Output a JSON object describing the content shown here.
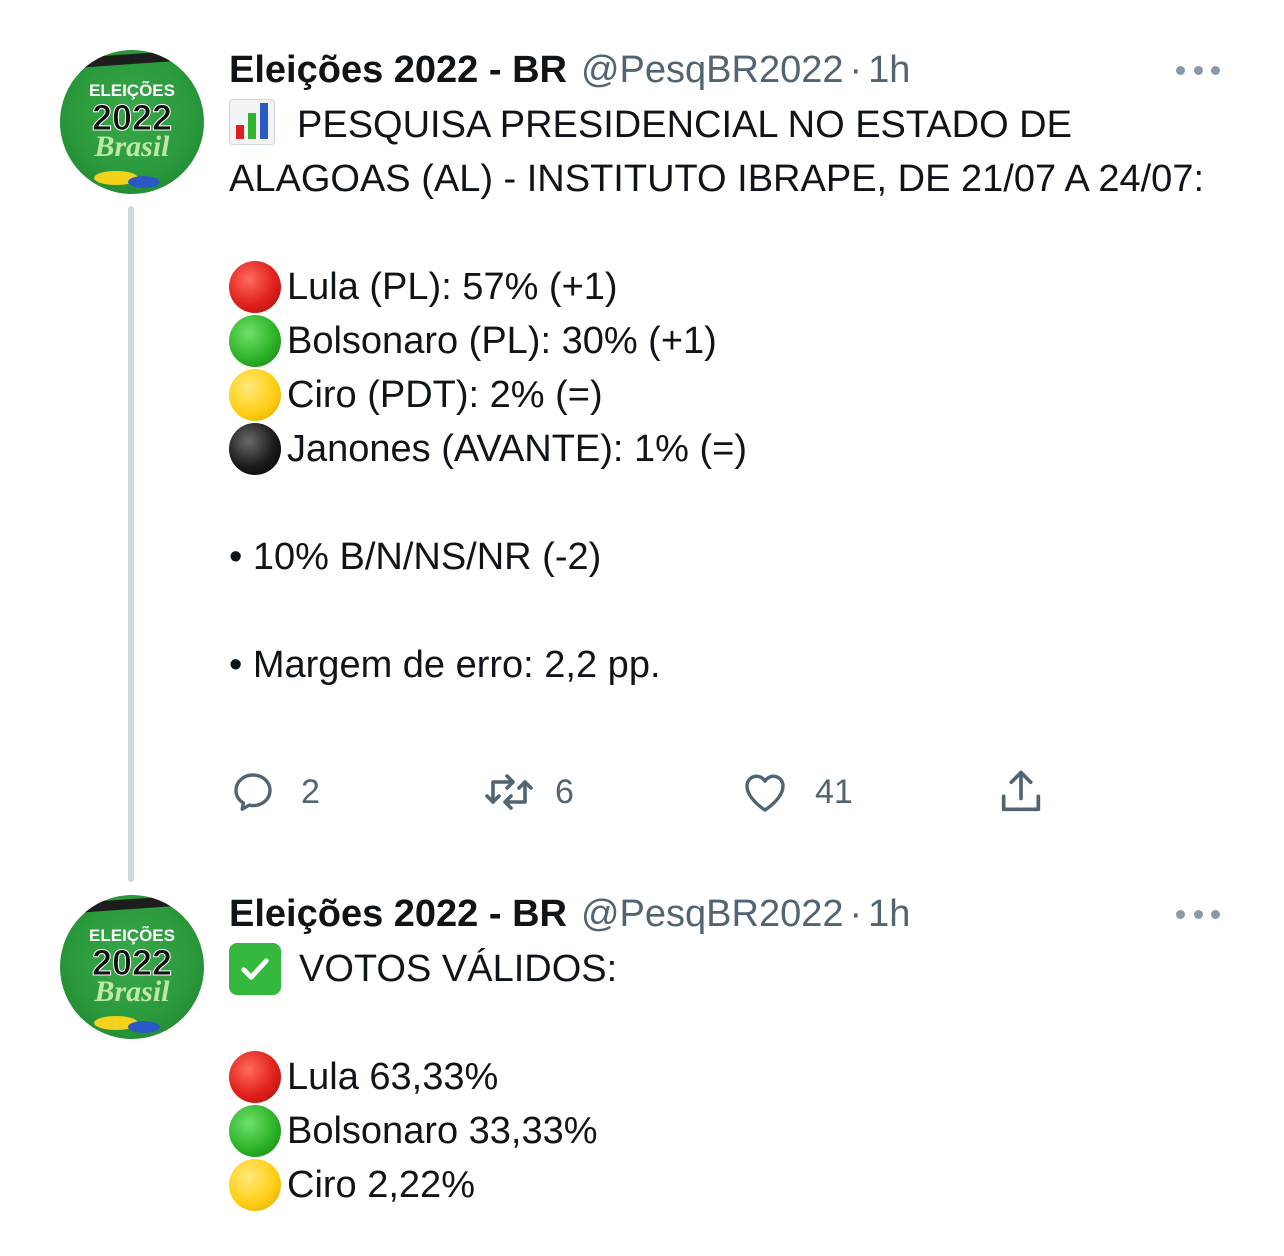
{
  "tweets": [
    {
      "author_name": "Eleições 2022 - BR",
      "handle": "@PesqBR2022",
      "separator": "·",
      "time": "1h",
      "avatar": {
        "line1": "ELEIÇÕES",
        "line2": "2022",
        "line3": "Brasil"
      },
      "headline_icon": "bar-chart-emoji",
      "headline": "PESQUISA PRESIDENCIAL NO ESTADO DE ALAGOAS (AL) - INSTITUTO IBRAPE, DE 21/07 A 24/07:",
      "candidates": [
        {
          "icon": "red-circle-emoji",
          "color": "#e0211b",
          "text": "Lula (PL): 57% (+1)"
        },
        {
          "icon": "green-circle-emoji",
          "color": "#2fb42a",
          "text": "Bolsonaro (PL): 30% (+1)"
        },
        {
          "icon": "yellow-circle-emoji",
          "color": "#ffcf16",
          "text": "Ciro (PDT): 2% (=)"
        },
        {
          "icon": "black-circle-emoji",
          "color": "#000000",
          "text": "Janones (AVANTE): 1% (=)"
        }
      ],
      "note1": "• 10% B/N/NS/NR (-2)",
      "note2": "• Margem de erro: 2,2 pp.",
      "actions": {
        "reply_count": "2",
        "retweet_count": "6",
        "like_count": "41"
      }
    },
    {
      "author_name": "Eleições 2022 - BR",
      "handle": "@PesqBR2022",
      "separator": "·",
      "time": "1h",
      "avatar": {
        "line1": "ELEIÇÕES",
        "line2": "2022",
        "line3": "Brasil"
      },
      "headline_icon": "check-mark-emoji",
      "headline": "VOTOS VÁLIDOS:",
      "candidates": [
        {
          "icon": "red-circle-emoji",
          "color": "#e0211b",
          "text": "Lula 63,33%"
        },
        {
          "icon": "green-circle-emoji",
          "color": "#2fb42a",
          "text": "Bolsonaro 33,33%"
        },
        {
          "icon": "yellow-circle-emoji",
          "color": "#ffcf16",
          "text": "Ciro 2,22%"
        }
      ]
    }
  ],
  "colors": {
    "text": "#0f1419",
    "secondary": "#536471",
    "thread_line": "#cfd9de",
    "avatar_green": "#2a9a3c"
  }
}
